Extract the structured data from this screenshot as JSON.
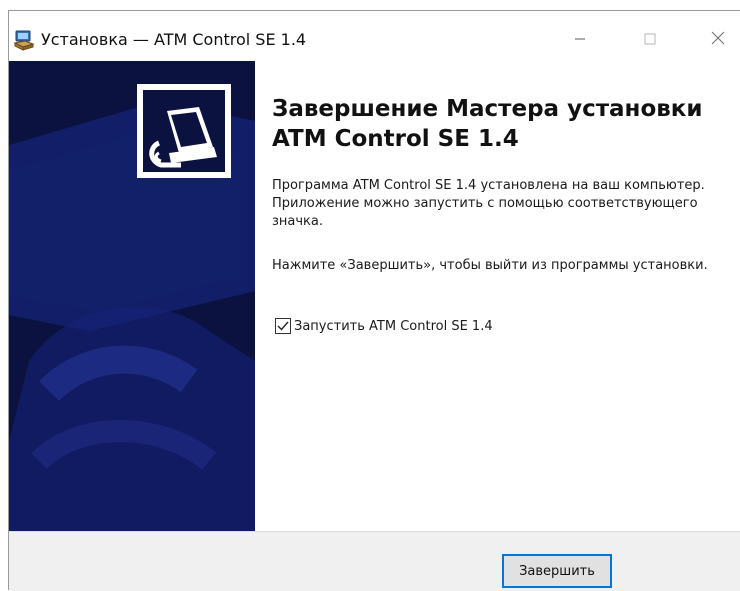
{
  "window": {
    "title": "Установка — ATM Control SE 1.4",
    "icon": "installer-icon",
    "controls": [
      "minimize-icon",
      "maximize-icon",
      "close-icon"
    ]
  },
  "sidebar": {
    "logo_icon": "atm-control-logo-icon",
    "background_color": "#0b123f"
  },
  "content": {
    "heading": "Завершение Мастера установки ATM Control SE 1.4",
    "paragraph1": "Программа ATM Control SE 1.4 установлена на ваш компьютер. Приложение можно запустить с помощью соответствующего значка.",
    "paragraph2": "Нажмите «Завершить», чтобы выйти из программы установки.",
    "run_checkbox": {
      "label": "Запустить ATM Control SE 1.4",
      "checked": true
    }
  },
  "footer": {
    "finish_label": "Завершить",
    "accent_color": "#0078d7"
  }
}
